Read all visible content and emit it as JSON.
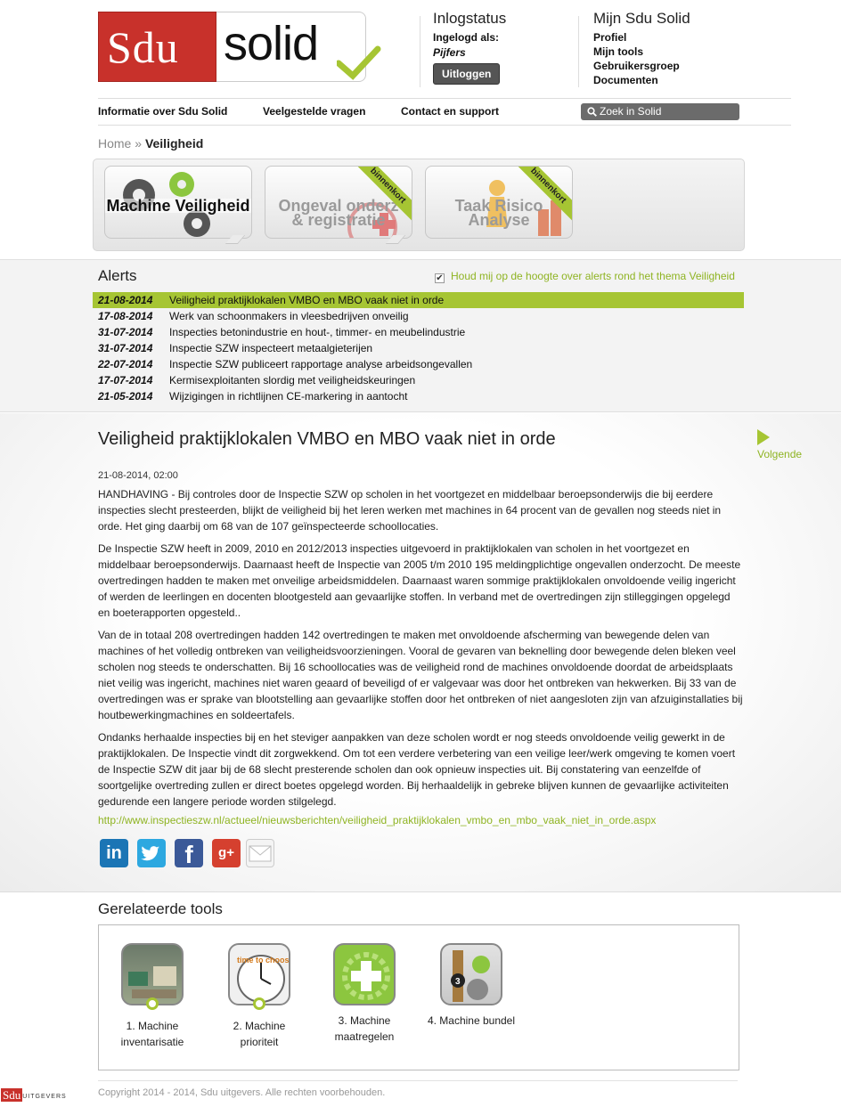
{
  "logo": {
    "left_text": "Sdu",
    "right_text": "solid"
  },
  "login": {
    "title": "Inlogstatus",
    "label": "Ingelogd als:",
    "user": "Pijfers",
    "logout_label": "Uitloggen"
  },
  "my_sdu": {
    "title": "Mijn Sdu Solid",
    "links": [
      "Profiel",
      "Mijn tools",
      "Gebruikersgroep",
      "Documenten"
    ]
  },
  "nav": {
    "items": [
      "Informatie over Sdu Solid",
      "Veelgestelde vragen",
      "Contact en support"
    ],
    "search_placeholder": "Zoek in Solid"
  },
  "breadcrumb": {
    "home": "Home",
    "sep": "»",
    "current": "Veiligheid"
  },
  "tiles": [
    {
      "label": "Machine Veiligheid",
      "ribbon": ""
    },
    {
      "label_line1": "Ongeval onderz",
      "label_line2": "& registratie",
      "ribbon": "binnenkort"
    },
    {
      "label_line1": "Taak Risico",
      "label_line2": "Analyse",
      "ribbon": "binnenkort"
    }
  ],
  "alerts": {
    "title": "Alerts",
    "subscribe_label": "Houd mij op de hoogte over alerts rond het thema Veiligheid",
    "subscribed": true,
    "items": [
      {
        "date": "21-08-2014",
        "title": "Veiligheid praktijklokalen VMBO en MBO vaak niet in orde"
      },
      {
        "date": "17-08-2014",
        "title": "Werk van schoonmakers in vleesbedrijven onveilig"
      },
      {
        "date": "31-07-2014",
        "title": "Inspecties betonindustrie en hout-, timmer- en meubelindustrie"
      },
      {
        "date": "31-07-2014",
        "title": "Inspectie SZW inspecteert metaalgieterijen"
      },
      {
        "date": "22-07-2014",
        "title": "Inspectie SZW publiceert rapportage analyse arbeidsongevallen"
      },
      {
        "date": "17-07-2014",
        "title": "Kermisexploitanten slordig met veiligheidskeuringen"
      },
      {
        "date": "21-05-2014",
        "title": "Wijzigingen in richtlijnen CE-markering in aantocht"
      }
    ]
  },
  "article": {
    "title": "Veiligheid praktijklokalen VMBO en MBO vaak niet in orde",
    "next_label": "Volgende",
    "date": "21-08-2014, 02:00",
    "paragraphs": [
      "HANDHAVING - Bij controles door de Inspectie SZW op scholen in het voortgezet en middelbaar beroepsonderwijs die bij eerdere inspecties slecht presteerden, blijkt de veiligheid bij het leren werken met machines in 64 procent van de gevallen nog steeds niet in orde. Het ging daarbij om 68 van de 107 geïnspecteerde schoollocaties.",
      "De Inspectie SZW heeft in 2009, 2010 en 2012/2013 inspecties uitgevoerd in praktijklokalen van scholen in het voortgezet en middelbaar beroepsonderwijs. Daarnaast heeft de Inspectie van 2005 t/m 2010 195 meldingplichtige ongevallen onderzocht. De meeste overtredingen hadden te maken met onveilige arbeidsmiddelen. Daarnaast waren sommige praktijklokalen onvoldoende veilig ingericht of werden de leerlingen en docenten blootgesteld aan gevaarlijke stoffen. In verband met de overtredingen zijn stilleggingen opgelegd en boeterapporten opgesteld..",
      "Van de in totaal 208 overtredingen hadden 142 overtredingen te maken met onvoldoende afscherming van bewegende delen van machines of het volledig ontbreken van veiligheidsvoorzieningen. Vooral de gevaren van beknelling door bewegende delen bleken veel scholen nog steeds te onderschatten. Bij 16 schoollocaties was de veiligheid rond de machines onvoldoende doordat de arbeidsplaats niet veilig was ingericht, machines niet waren geaard of beveiligd of er valgevaar was door het ontbreken van hekwerken. Bij 33 van de overtredingen was er sprake van blootstelling aan gevaarlijke stoffen door het ontbreken of niet aangesloten zijn van afzuiginstallaties bij houtbewerkingmachines en soldeertafels.",
      "Ondanks herhaalde inspecties bij en het steviger aanpakken van deze scholen wordt er nog steeds onvoldoende veilig gewerkt in de praktijklokalen. De Inspectie vindt dit zorgwekkend. Om tot een verdere verbetering van een veilige leer/werk omgeving te komen voert de Inspectie SZW dit jaar bij de 68 slecht presterende scholen dan ook opnieuw inspecties uit.  Bij constatering van eenzelfde of soortgelijke overtreding zullen er direct boetes opgelegd worden. Bij herhaaldelijk in gebreke blijven kunnen de gevaarlijke activiteiten gedurende een langere periode worden stilgelegd."
    ],
    "source_link": "http://www.inspectieszw.nl/actueel/nieuwsberichten/veiligheid_praktijklokalen_vmbo_en_mbo_vaak_niet_in_orde.aspx",
    "share": {
      "linkedin": "in",
      "twitter": "t",
      "facebook": "f",
      "googleplus": "g+",
      "email": "mail"
    }
  },
  "related": {
    "title": "Gerelateerde tools",
    "tools": [
      {
        "line1": "1. Machine",
        "line2": "inventarisatie"
      },
      {
        "line1": "2. Machine",
        "line2": "prioriteit",
        "badge": "time to choose"
      },
      {
        "line1": "3. Machine",
        "line2": "maatregelen"
      },
      {
        "line1": "4. Machine bundel",
        "line2": "",
        "badge": "3"
      }
    ]
  },
  "footer": {
    "copyright": "Copyright 2014 - 2014, Sdu uitgevers. Alle rechten voorbehouden.",
    "logo_text": "Sdu",
    "logo_sub": "UITGEVERS"
  },
  "colors": {
    "accent_green": "#a6c533",
    "brand_red": "#c8312b"
  }
}
